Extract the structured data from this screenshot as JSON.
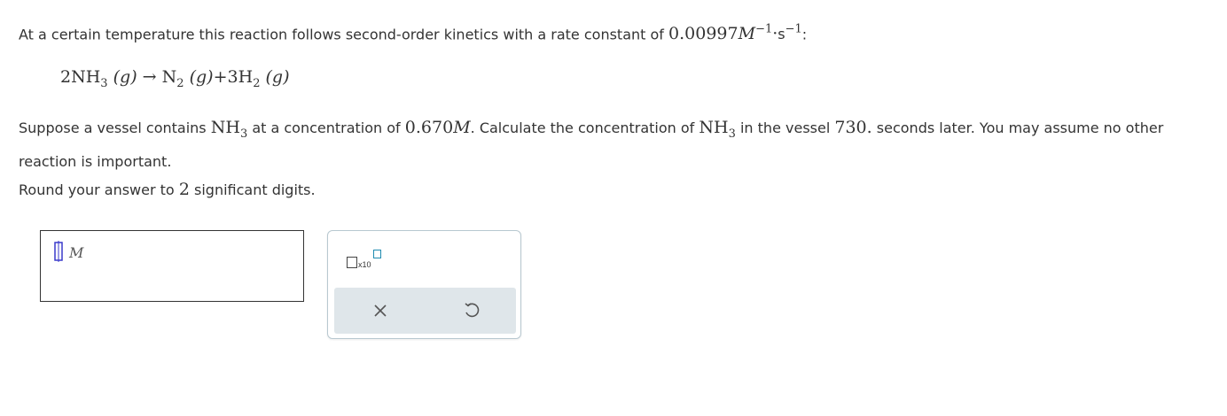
{
  "question": {
    "intro": "At a certain temperature this reaction follows second-order kinetics with a rate constant of",
    "rate_value": "0.00997",
    "rate_unit_M": "M",
    "rate_exp_1": "−1",
    "rate_dot": "·",
    "rate_unit_s": "s",
    "rate_exp_2": "−1",
    "rate_colon": ":",
    "equation": {
      "coef1": "2NH",
      "sub1": "3",
      "phase1": "(g)",
      "arrow": "→",
      "prod1": "N",
      "sub2": "2",
      "phase2": "(g)",
      "plus": "+",
      "prod2": "3H",
      "sub3": "2",
      "phase3": "(g)"
    },
    "p2_a": "Suppose a vessel contains",
    "nh": "NH",
    "sub_3": "3",
    "p2_b": "at a concentration of",
    "conc_value": "0.670",
    "conc_unit": "M",
    "p2_c": ". Calculate the concentration of",
    "p2_d": "in the vessel",
    "time_value": "730.",
    "p2_e": "seconds later. You may assume no other reaction is important.",
    "p3_a": "Round your answer to",
    "sig_digits": "2",
    "p3_b": "significant digits."
  },
  "answer": {
    "unit": "M",
    "value": ""
  },
  "tools": {
    "sci_label": "x10"
  },
  "colors": {
    "accent": "#1f8bb0",
    "cursor": "#3a3acb",
    "toolbar_bg": "#dfe6ea"
  }
}
